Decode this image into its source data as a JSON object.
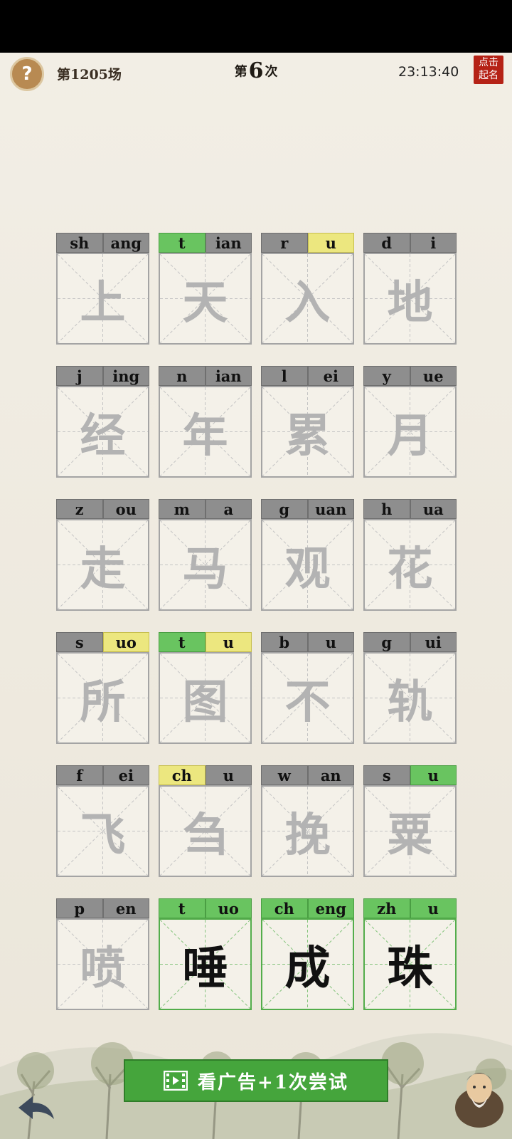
{
  "header": {
    "help_symbol": "?",
    "round_label": "第1205场",
    "attempt_prefix": "第",
    "attempt_number": "6",
    "attempt_suffix": "次",
    "clock": "23:13:40",
    "seal_line1": "点击",
    "seal_line2": "起名"
  },
  "cells": [
    {
      "initial": "sh",
      "final": "ang",
      "initial_state": "gray",
      "final_state": "gray",
      "char": "上",
      "solved": false
    },
    {
      "initial": "t",
      "final": "ian",
      "initial_state": "green",
      "final_state": "gray",
      "char": "天",
      "solved": false
    },
    {
      "initial": "r",
      "final": "u",
      "initial_state": "gray",
      "final_state": "yellow",
      "char": "入",
      "solved": false
    },
    {
      "initial": "d",
      "final": "i",
      "initial_state": "gray",
      "final_state": "gray",
      "char": "地",
      "solved": false
    },
    {
      "initial": "j",
      "final": "ing",
      "initial_state": "gray",
      "final_state": "gray",
      "char": "经",
      "solved": false
    },
    {
      "initial": "n",
      "final": "ian",
      "initial_state": "gray",
      "final_state": "gray",
      "char": "年",
      "solved": false
    },
    {
      "initial": "l",
      "final": "ei",
      "initial_state": "gray",
      "final_state": "gray",
      "char": "累",
      "solved": false
    },
    {
      "initial": "y",
      "final": "ue",
      "initial_state": "gray",
      "final_state": "gray",
      "char": "月",
      "solved": false
    },
    {
      "initial": "z",
      "final": "ou",
      "initial_state": "gray",
      "final_state": "gray",
      "char": "走",
      "solved": false
    },
    {
      "initial": "m",
      "final": "a",
      "initial_state": "gray",
      "final_state": "gray",
      "char": "马",
      "solved": false
    },
    {
      "initial": "g",
      "final": "uan",
      "initial_state": "gray",
      "final_state": "gray",
      "char": "观",
      "solved": false
    },
    {
      "initial": "h",
      "final": "ua",
      "initial_state": "gray",
      "final_state": "gray",
      "char": "花",
      "solved": false
    },
    {
      "initial": "s",
      "final": "uo",
      "initial_state": "gray",
      "final_state": "yellow",
      "char": "所",
      "solved": false
    },
    {
      "initial": "t",
      "final": "u",
      "initial_state": "green",
      "final_state": "yellow",
      "char": "图",
      "solved": false
    },
    {
      "initial": "b",
      "final": "u",
      "initial_state": "gray",
      "final_state": "gray",
      "char": "不",
      "solved": false
    },
    {
      "initial": "g",
      "final": "ui",
      "initial_state": "gray",
      "final_state": "gray",
      "char": "轨",
      "solved": false
    },
    {
      "initial": "f",
      "final": "ei",
      "initial_state": "gray",
      "final_state": "gray",
      "char": "飞",
      "solved": false
    },
    {
      "initial": "ch",
      "final": "u",
      "initial_state": "yellow",
      "final_state": "gray",
      "char": "刍",
      "solved": false
    },
    {
      "initial": "w",
      "final": "an",
      "initial_state": "gray",
      "final_state": "gray",
      "char": "挽",
      "solved": false
    },
    {
      "initial": "s",
      "final": "u",
      "initial_state": "gray",
      "final_state": "green",
      "char": "粟",
      "solved": false
    },
    {
      "initial": "p",
      "final": "en",
      "initial_state": "gray",
      "final_state": "gray",
      "char": "喷",
      "solved": false
    },
    {
      "initial": "t",
      "final": "uo",
      "initial_state": "green",
      "final_state": "green",
      "char": "唾",
      "solved": true
    },
    {
      "initial": "ch",
      "final": "eng",
      "initial_state": "green",
      "final_state": "green",
      "char": "成",
      "solved": true
    },
    {
      "initial": "zh",
      "final": "u",
      "initial_state": "green",
      "final_state": "green",
      "char": "珠",
      "solved": true
    }
  ],
  "footer": {
    "ad_button_label": "看广告+1次尝试",
    "back_icon": "back-arrow-icon",
    "ad_icon": "film-icon",
    "avatar_icon": "sage-avatar-icon"
  },
  "colors": {
    "tile_green": "#69c460",
    "tile_yellow": "#ece77f",
    "tile_gray": "#8e8e8e",
    "ad_button": "#45a53c",
    "seal_red": "#b52216"
  }
}
